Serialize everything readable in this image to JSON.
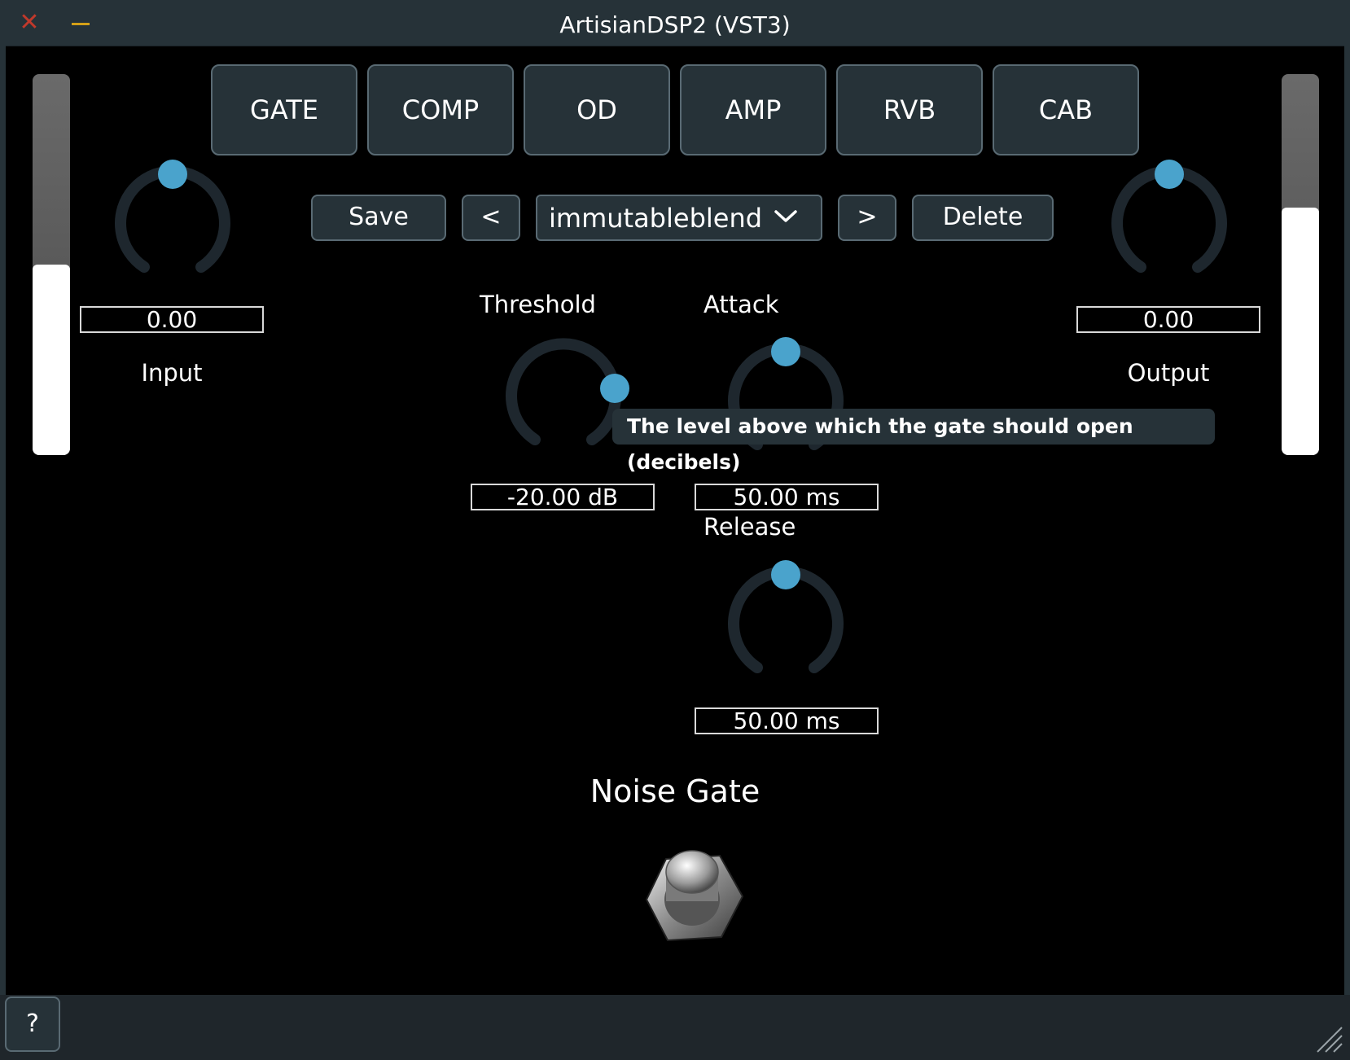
{
  "window": {
    "title": "ArtisianDSP2 (VST3)",
    "close_icon": "close-icon",
    "minimize_icon": "minimize-icon"
  },
  "tabs": [
    {
      "label": "GATE"
    },
    {
      "label": "COMP"
    },
    {
      "label": "OD"
    },
    {
      "label": "AMP"
    },
    {
      "label": "RVB"
    },
    {
      "label": "CAB"
    }
  ],
  "presets": {
    "save_label": "Save",
    "prev_label": "<",
    "current": "immutableblend",
    "next_label": ">",
    "delete_label": "Delete"
  },
  "input": {
    "value": "0.00",
    "label": "Input",
    "meter_level": 0.5
  },
  "output": {
    "value": "0.00",
    "label": "Output",
    "meter_level": 0.65
  },
  "gate": {
    "title": "Noise Gate",
    "threshold": {
      "label": "Threshold",
      "value": "-20.00 dB"
    },
    "attack": {
      "label": "Attack",
      "value": "50.00 ms"
    },
    "release": {
      "label": "Release",
      "value": "50.00 ms"
    },
    "tooltip": "The level above which the gate should open (decibels)"
  },
  "footer": {
    "help_label": "?"
  },
  "colors": {
    "accent": "#4aa3cc",
    "panel": "#263238",
    "track": "#1e272e"
  }
}
